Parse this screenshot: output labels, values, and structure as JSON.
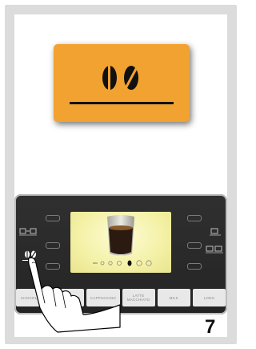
{
  "badge": {
    "icon": "coffee-bean-strength-icon",
    "accent": "#f2a231"
  },
  "machine": {
    "icons": {
      "left_top": "cup-to-cup-icon",
      "left_selected": "coffee-bean-strength-icon",
      "right_top": "single-cup-icon",
      "right_mid": "double-cup-icon",
      "display": "espresso-glass-icon"
    },
    "drinks": [
      "CHOCOLATE",
      "CAFFELATTE",
      "CAPPUCCINO",
      "LATTE MACCHIATO",
      "MILK",
      "LONG"
    ]
  },
  "page_number": "7"
}
